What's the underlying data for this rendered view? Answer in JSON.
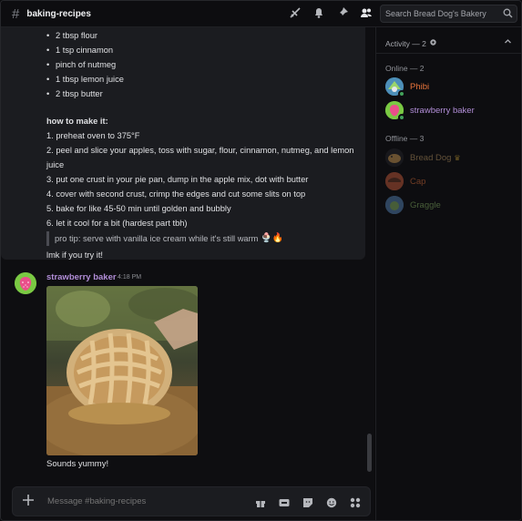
{
  "header": {
    "channel_name": "baking-recipes",
    "search_placeholder": "Search Bread Dog's Bakery",
    "icons": [
      "threads-icon",
      "bell-icon",
      "pin-icon",
      "members-icon"
    ]
  },
  "message1": {
    "ingredients": [
      "2 tbsp flour",
      "1 tsp cinnamon",
      "pinch of nutmeg",
      "1 tbsp lemon juice",
      "2 tbsp butter"
    ],
    "howto_heading": "how to make it:",
    "steps": [
      "1. preheat oven to 375°F",
      "2. peel and slice your apples, toss with sugar, flour, cinnamon, nutmeg, and lemon juice",
      "3. put one crust in your pie pan, dump in the apple mix, dot with butter",
      "4. cover with second crust, crimp the edges and cut some slits on top",
      "5. bake for like 45-50 min until golden and bubbly",
      "6. let it cool for a bit (hardest part tbh)"
    ],
    "tip": "pro tip: serve with vanilla ice cream while it's still warm",
    "tip_emojis": "🍨🔥",
    "closing": "lmk if you try it!"
  },
  "message2": {
    "author": "strawberry baker",
    "timestamp": "4:18 PM",
    "image_alt": "lattice-top apple pie",
    "text": "Sounds yummy!"
  },
  "composer": {
    "placeholder": "Message #baking-recipes",
    "icons": [
      "gift-icon",
      "gif-icon",
      "sticker-icon",
      "emoji-icon",
      "apps-icon"
    ]
  },
  "members": {
    "activity_label": "Activity — 2",
    "online_title": "Online — 2",
    "online": [
      {
        "name": "Phibi",
        "color": "#e8743b"
      },
      {
        "name": "strawberry baker",
        "color": "#b28ed8"
      }
    ],
    "offline_title": "Offline — 3",
    "offline": [
      {
        "name": "Bread Dog",
        "color": "#c9a36a"
      },
      {
        "name": "Cap",
        "color": "#e8743b"
      },
      {
        "name": "Graggle",
        "color": "#8fbf6a"
      }
    ]
  }
}
